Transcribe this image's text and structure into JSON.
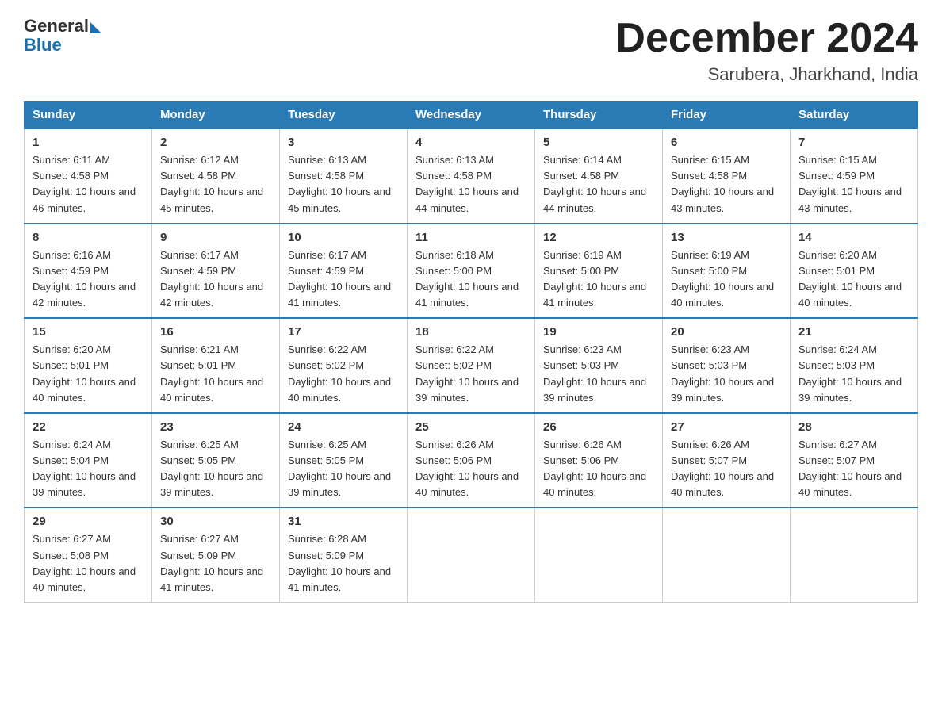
{
  "logo": {
    "general": "General",
    "blue": "Blue"
  },
  "title": "December 2024",
  "location": "Sarubera, Jharkhand, India",
  "days_of_week": [
    "Sunday",
    "Monday",
    "Tuesday",
    "Wednesday",
    "Thursday",
    "Friday",
    "Saturday"
  ],
  "weeks": [
    [
      {
        "day": "1",
        "sunrise": "6:11 AM",
        "sunset": "4:58 PM",
        "daylight": "10 hours and 46 minutes."
      },
      {
        "day": "2",
        "sunrise": "6:12 AM",
        "sunset": "4:58 PM",
        "daylight": "10 hours and 45 minutes."
      },
      {
        "day": "3",
        "sunrise": "6:13 AM",
        "sunset": "4:58 PM",
        "daylight": "10 hours and 45 minutes."
      },
      {
        "day": "4",
        "sunrise": "6:13 AM",
        "sunset": "4:58 PM",
        "daylight": "10 hours and 44 minutes."
      },
      {
        "day": "5",
        "sunrise": "6:14 AM",
        "sunset": "4:58 PM",
        "daylight": "10 hours and 44 minutes."
      },
      {
        "day": "6",
        "sunrise": "6:15 AM",
        "sunset": "4:58 PM",
        "daylight": "10 hours and 43 minutes."
      },
      {
        "day": "7",
        "sunrise": "6:15 AM",
        "sunset": "4:59 PM",
        "daylight": "10 hours and 43 minutes."
      }
    ],
    [
      {
        "day": "8",
        "sunrise": "6:16 AM",
        "sunset": "4:59 PM",
        "daylight": "10 hours and 42 minutes."
      },
      {
        "day": "9",
        "sunrise": "6:17 AM",
        "sunset": "4:59 PM",
        "daylight": "10 hours and 42 minutes."
      },
      {
        "day": "10",
        "sunrise": "6:17 AM",
        "sunset": "4:59 PM",
        "daylight": "10 hours and 41 minutes."
      },
      {
        "day": "11",
        "sunrise": "6:18 AM",
        "sunset": "5:00 PM",
        "daylight": "10 hours and 41 minutes."
      },
      {
        "day": "12",
        "sunrise": "6:19 AM",
        "sunset": "5:00 PM",
        "daylight": "10 hours and 41 minutes."
      },
      {
        "day": "13",
        "sunrise": "6:19 AM",
        "sunset": "5:00 PM",
        "daylight": "10 hours and 40 minutes."
      },
      {
        "day": "14",
        "sunrise": "6:20 AM",
        "sunset": "5:01 PM",
        "daylight": "10 hours and 40 minutes."
      }
    ],
    [
      {
        "day": "15",
        "sunrise": "6:20 AM",
        "sunset": "5:01 PM",
        "daylight": "10 hours and 40 minutes."
      },
      {
        "day": "16",
        "sunrise": "6:21 AM",
        "sunset": "5:01 PM",
        "daylight": "10 hours and 40 minutes."
      },
      {
        "day": "17",
        "sunrise": "6:22 AM",
        "sunset": "5:02 PM",
        "daylight": "10 hours and 40 minutes."
      },
      {
        "day": "18",
        "sunrise": "6:22 AM",
        "sunset": "5:02 PM",
        "daylight": "10 hours and 39 minutes."
      },
      {
        "day": "19",
        "sunrise": "6:23 AM",
        "sunset": "5:03 PM",
        "daylight": "10 hours and 39 minutes."
      },
      {
        "day": "20",
        "sunrise": "6:23 AM",
        "sunset": "5:03 PM",
        "daylight": "10 hours and 39 minutes."
      },
      {
        "day": "21",
        "sunrise": "6:24 AM",
        "sunset": "5:03 PM",
        "daylight": "10 hours and 39 minutes."
      }
    ],
    [
      {
        "day": "22",
        "sunrise": "6:24 AM",
        "sunset": "5:04 PM",
        "daylight": "10 hours and 39 minutes."
      },
      {
        "day": "23",
        "sunrise": "6:25 AM",
        "sunset": "5:05 PM",
        "daylight": "10 hours and 39 minutes."
      },
      {
        "day": "24",
        "sunrise": "6:25 AM",
        "sunset": "5:05 PM",
        "daylight": "10 hours and 39 minutes."
      },
      {
        "day": "25",
        "sunrise": "6:26 AM",
        "sunset": "5:06 PM",
        "daylight": "10 hours and 40 minutes."
      },
      {
        "day": "26",
        "sunrise": "6:26 AM",
        "sunset": "5:06 PM",
        "daylight": "10 hours and 40 minutes."
      },
      {
        "day": "27",
        "sunrise": "6:26 AM",
        "sunset": "5:07 PM",
        "daylight": "10 hours and 40 minutes."
      },
      {
        "day": "28",
        "sunrise": "6:27 AM",
        "sunset": "5:07 PM",
        "daylight": "10 hours and 40 minutes."
      }
    ],
    [
      {
        "day": "29",
        "sunrise": "6:27 AM",
        "sunset": "5:08 PM",
        "daylight": "10 hours and 40 minutes."
      },
      {
        "day": "30",
        "sunrise": "6:27 AM",
        "sunset": "5:09 PM",
        "daylight": "10 hours and 41 minutes."
      },
      {
        "day": "31",
        "sunrise": "6:28 AM",
        "sunset": "5:09 PM",
        "daylight": "10 hours and 41 minutes."
      },
      null,
      null,
      null,
      null
    ]
  ]
}
